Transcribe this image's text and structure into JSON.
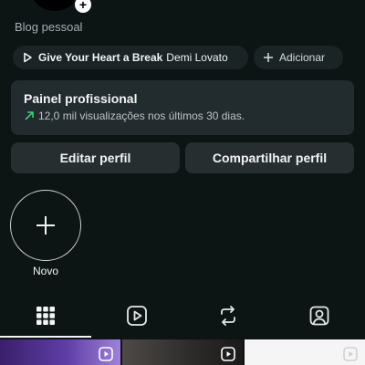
{
  "profile": {
    "category": "Blog pessoal"
  },
  "chips": {
    "music_song": "Give Your Heart a Break",
    "music_artist": "Demi Lovato",
    "add_label": "Adicionar"
  },
  "panel": {
    "title": "Painel profissional",
    "stats": "12,0 mil visualizações nos últimos 30 dias."
  },
  "buttons": {
    "edit": "Editar perfil",
    "share": "Compartilhar perfil"
  },
  "highlights": {
    "new_label": "Novo"
  },
  "tabs": [
    {
      "icon": "grid-icon",
      "active": true
    },
    {
      "icon": "reels-icon",
      "active": false
    },
    {
      "icon": "repost-icon",
      "active": false
    },
    {
      "icon": "tagged-icon",
      "active": false
    }
  ],
  "colors": {
    "background": "#0c1414",
    "card": "#222b2d",
    "accent_green": "#3cd070"
  }
}
